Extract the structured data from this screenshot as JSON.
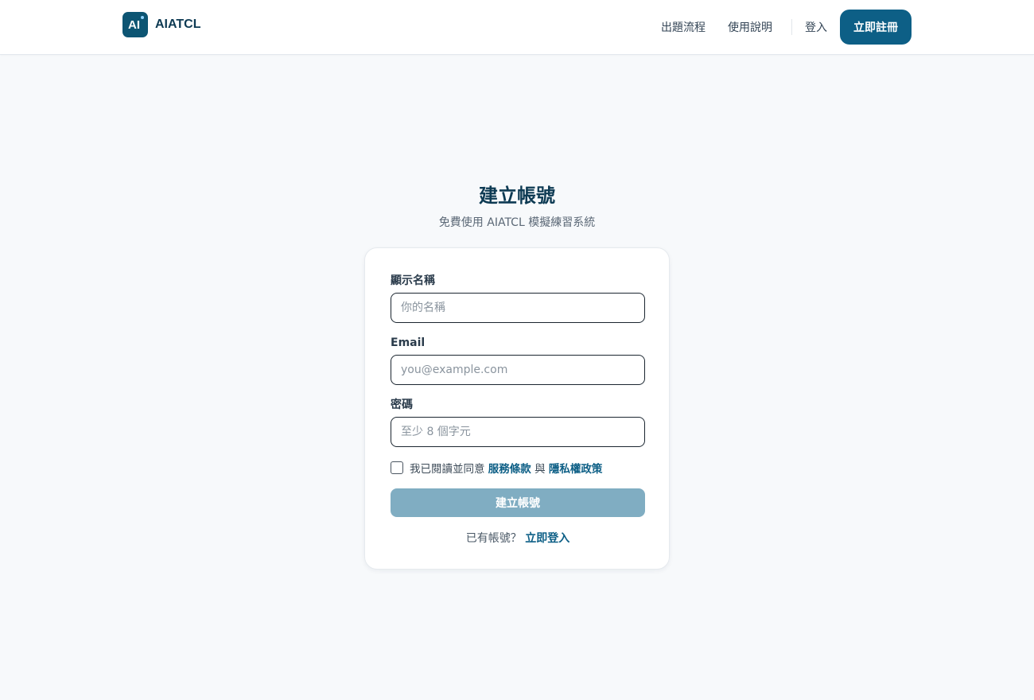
{
  "header": {
    "brand_logo_text": "AI",
    "brand_name": "AIATCL",
    "nav": {
      "flow": "出題流程",
      "guide": "使用說明",
      "login": "登入",
      "register": "立即註冊"
    }
  },
  "page": {
    "title": "建立帳號",
    "subtitle": "免費使用 AIATCL 模擬練習系統"
  },
  "form": {
    "name": {
      "label": "顯示名稱",
      "placeholder": "你的名稱",
      "value": ""
    },
    "email": {
      "label": "Email",
      "placeholder": "you@example.com",
      "value": ""
    },
    "password": {
      "label": "密碼",
      "placeholder": "至少 8 個字元",
      "value": ""
    },
    "agreement": {
      "checked": false,
      "prefix": "我已閱讀並同意 ",
      "terms_link": "服務條款",
      "joiner": " 與 ",
      "privacy_link": "隱私權政策"
    },
    "submit_label": "建立帳號",
    "switch": {
      "prompt": "已有帳號？ ",
      "link": "立即登入"
    }
  },
  "colors": {
    "brand": "#0d5f86",
    "brand_dark": "#0d3a53",
    "submit_disabled": "#80adc2",
    "background": "#f7f9fb"
  }
}
